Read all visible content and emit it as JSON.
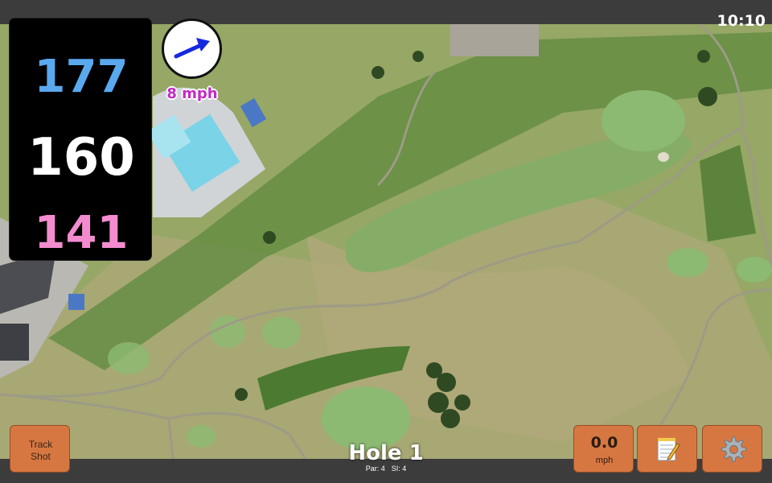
{
  "status_bar": {
    "time": "10:10"
  },
  "distances": {
    "back": "177",
    "middle": "160",
    "front": "141"
  },
  "wind": {
    "speed_text": "8 mph",
    "direction_icon": "arrow-right-icon",
    "arrow_color": "#1428e0"
  },
  "hole": {
    "title": "Hole 1",
    "par": "Par: 4",
    "si": "SI: 4"
  },
  "buttons": {
    "track_shot_line1": "Track",
    "track_shot_line2": "Shot",
    "speed_value": "0.0",
    "speed_unit": "mph",
    "notes_icon": "notepad-icon",
    "settings_icon": "gear-icon"
  },
  "colors": {
    "back_distance": "#5aa9ef",
    "middle_distance": "#ffffff",
    "front_distance": "#f28ccf",
    "button_bg": "#d67742",
    "wind_text": "#c22bc4"
  }
}
